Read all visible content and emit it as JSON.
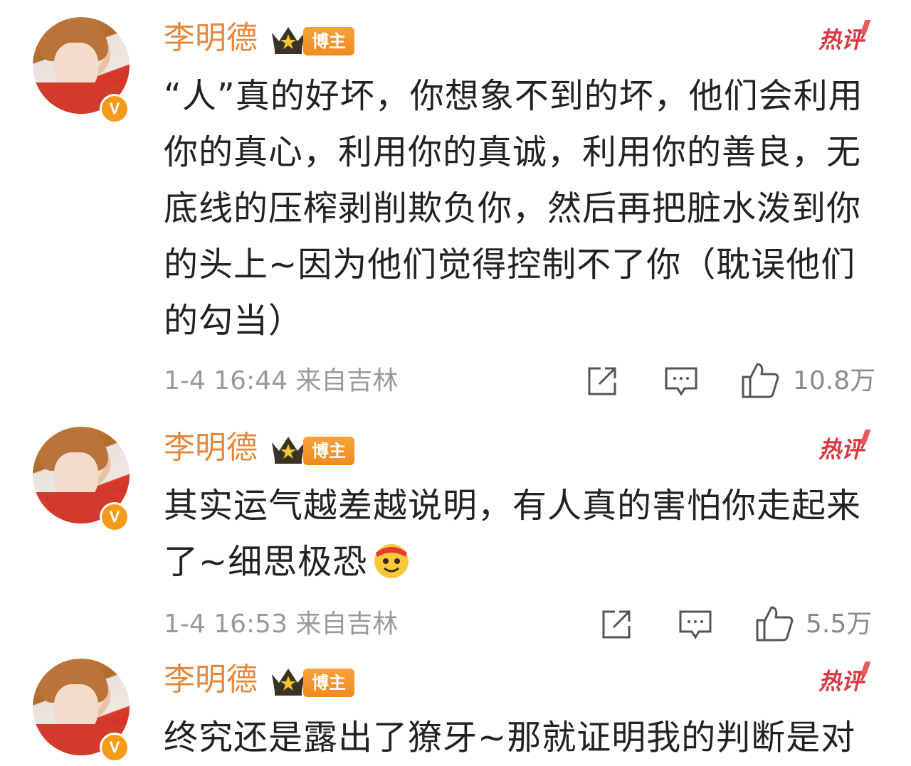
{
  "comments": [
    {
      "username": "李明德",
      "badge": "博主",
      "hot_label": "热评",
      "text": "“人”真的好坏，你想象不到的坏，他们会利用你的真心，利用你的真诚，利用你的善良，无底线的压榨剥削欺负你，然后再把脏水泼到你的头上~因为他们觉得控制不了你（耽误他们的勾当）",
      "meta": "1-4 16:44 来自吉林",
      "likes": "10.8万"
    },
    {
      "username": "李明德",
      "badge": "博主",
      "hot_label": "热评",
      "text": "其实运气越差越说明，有人真的害怕你走起来了~细思极恐",
      "meta": "1-4 16:53 来自吉林",
      "likes": "5.5万"
    },
    {
      "username": "李明德",
      "badge": "博主",
      "hot_label": "热评",
      "text": "终究还是露出了獠牙~那就证明我的判断是对"
    }
  ],
  "icons": {
    "share": "share-icon",
    "comment": "comment-icon",
    "like": "thumbs-up-icon",
    "verified": "verified-v-icon",
    "crown": "crown-icon",
    "emoji": "grin-emoji-icon"
  },
  "colors": {
    "username": "#e8873a",
    "hot": "#d9383e",
    "badge": "#ef8a1e",
    "meta": "#9a9a9a"
  }
}
